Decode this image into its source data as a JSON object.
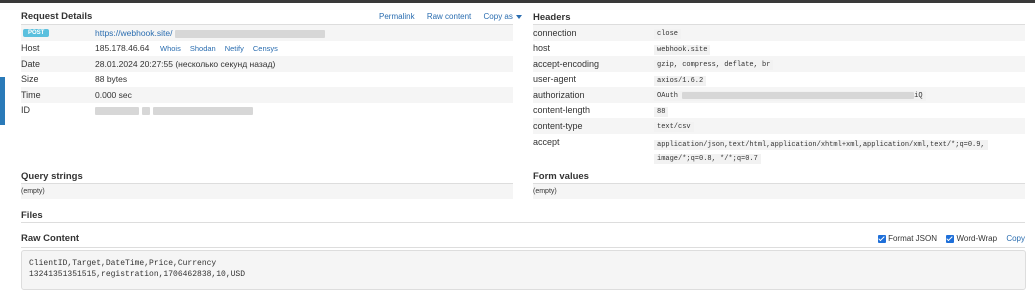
{
  "request": {
    "title": "Request Details",
    "links": [
      "Permalink",
      "Raw content",
      "Copy as"
    ],
    "method": "POST",
    "url": "https://webhook.site/",
    "rows": [
      {
        "label": "Host",
        "value": "185.178.46.64"
      },
      {
        "label": "Date",
        "value": "28.01.2024 20:27:55 (несколько секунд назад)"
      },
      {
        "label": "Size",
        "value": "88 bytes"
      },
      {
        "label": "Time",
        "value": "0.000 sec"
      },
      {
        "label": "ID",
        "value": ""
      }
    ],
    "host_tools": [
      "Whois",
      "Shodan",
      "Netify",
      "Censys"
    ]
  },
  "headers": {
    "title": "Headers",
    "rows": [
      {
        "label": "connection",
        "value": "close"
      },
      {
        "label": "host",
        "value": "webhook.site"
      },
      {
        "label": "accept-encoding",
        "value": "gzip, compress, deflate, br"
      },
      {
        "label": "user-agent",
        "value": "axios/1.6.2"
      },
      {
        "label": "authorization",
        "value": "OAuth",
        "value_tail": "iQ"
      },
      {
        "label": "content-length",
        "value": "88"
      },
      {
        "label": "content-type",
        "value": "text/csv"
      },
      {
        "label": "accept",
        "value": "application/json,text/html,application/xhtml+xml,application/xml,text/*;q=0.9,",
        "value2": "image/*;q=0.8, */*;q=0.7"
      }
    ]
  },
  "query": {
    "title": "Query strings",
    "empty": "(empty)"
  },
  "form": {
    "title": "Form values",
    "empty": "(empty)"
  },
  "files": {
    "title": "Files"
  },
  "raw": {
    "title": "Raw Content",
    "format_json": "Format JSON",
    "word_wrap": "Word-Wrap",
    "copy": "Copy",
    "line1": "ClientID,Target,DateTime,Price,Currency",
    "line2": "13241351351515,registration,1706462838,10,USD"
  }
}
